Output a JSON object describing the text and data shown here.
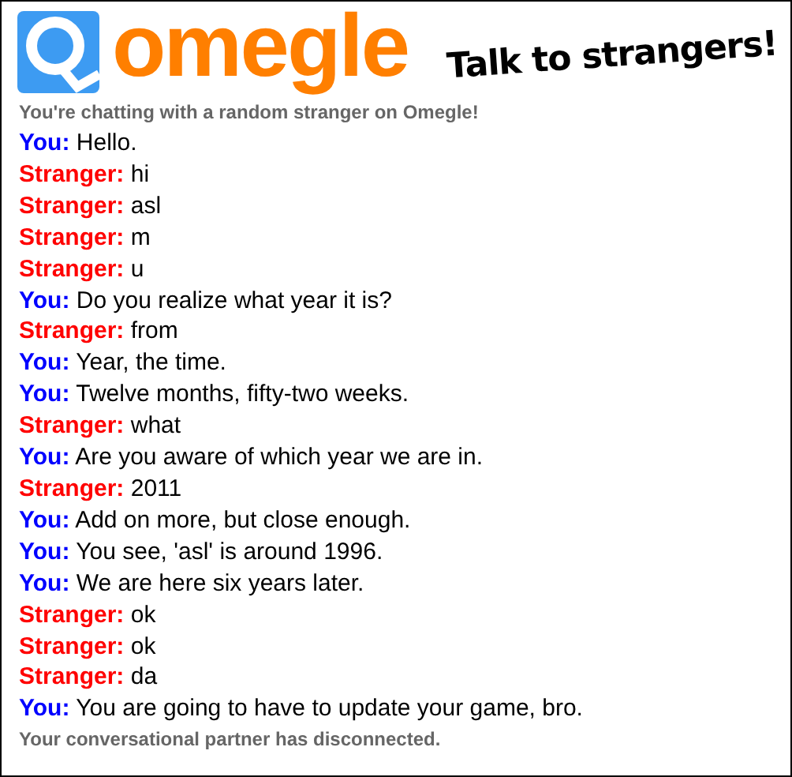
{
  "header": {
    "logo_text": "omegle",
    "tagline": "Talk to strangers!"
  },
  "status_top": "You're chatting with a random stranger on Omegle!",
  "messages": [
    {
      "kind": "you",
      "speaker": "You:",
      "text": "Hello."
    },
    {
      "kind": "stranger",
      "speaker": "Stranger:",
      "text": "hi"
    },
    {
      "kind": "stranger",
      "speaker": "Stranger:",
      "text": "asl"
    },
    {
      "kind": "stranger",
      "speaker": "Stranger:",
      "text": "m"
    },
    {
      "kind": "stranger",
      "speaker": "Stranger:",
      "text": "u"
    },
    {
      "kind": "you",
      "speaker": "You:",
      "text": "Do you realize what year it is?"
    },
    {
      "kind": "stranger",
      "speaker": "Stranger:",
      "text": "from"
    },
    {
      "kind": "you",
      "speaker": "You:",
      "text": "Year, the time."
    },
    {
      "kind": "you",
      "speaker": "You:",
      "text": "Twelve months, fifty-two weeks."
    },
    {
      "kind": "stranger",
      "speaker": "Stranger:",
      "text": "what"
    },
    {
      "kind": "you",
      "speaker": "You:",
      "text": "Are you aware of which year we are in."
    },
    {
      "kind": "stranger",
      "speaker": "Stranger:",
      "text": "2011"
    },
    {
      "kind": "you",
      "speaker": "You:",
      "text": "Add on more, but close enough."
    },
    {
      "kind": "you",
      "speaker": "You:",
      "text": "You see, 'asl' is around 1996."
    },
    {
      "kind": "you",
      "speaker": "You:",
      "text": "We are here six years later."
    },
    {
      "kind": "stranger",
      "speaker": "Stranger:",
      "text": "ok"
    },
    {
      "kind": "stranger",
      "speaker": "Stranger:",
      "text": "ok"
    },
    {
      "kind": "stranger",
      "speaker": "Stranger:",
      "text": "da"
    },
    {
      "kind": "you",
      "speaker": "You:",
      "text": "You are going to have to update your game, bro."
    }
  ],
  "status_bottom": "Your conversational partner has disconnected."
}
